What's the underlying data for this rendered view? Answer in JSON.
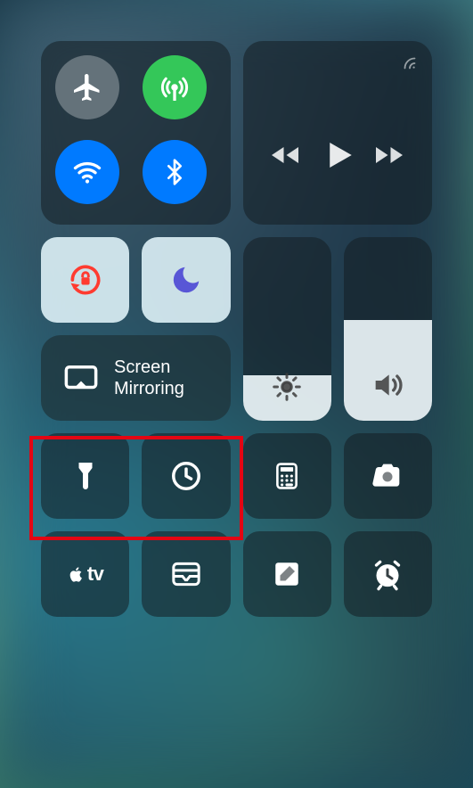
{
  "connectivity": {
    "airplane": {
      "active": false
    },
    "cellular": {
      "active": true
    },
    "wifi": {
      "active": true
    },
    "bluetooth": {
      "active": true
    }
  },
  "media": {
    "airplay_available": true
  },
  "toggles": {
    "orientation_lock": {
      "active": true
    },
    "dnd": {
      "active": true
    }
  },
  "screen_mirroring": {
    "line1": "Screen",
    "line2": "Mirroring"
  },
  "sliders": {
    "brightness_percent": 25,
    "volume_percent": 55
  },
  "shortcuts": {
    "flashlight": "flashlight",
    "timer": "timer",
    "calculator": "calculator",
    "camera": "camera",
    "apple_tv": "tv",
    "wallet": "wallet",
    "notes": "notes",
    "alarm": "alarm"
  },
  "colors": {
    "active_green": "#34c759",
    "active_blue": "#007aff",
    "highlight_red": "#e30613",
    "lock_red": "#ff3b30",
    "dnd_purple": "#5856d6"
  }
}
